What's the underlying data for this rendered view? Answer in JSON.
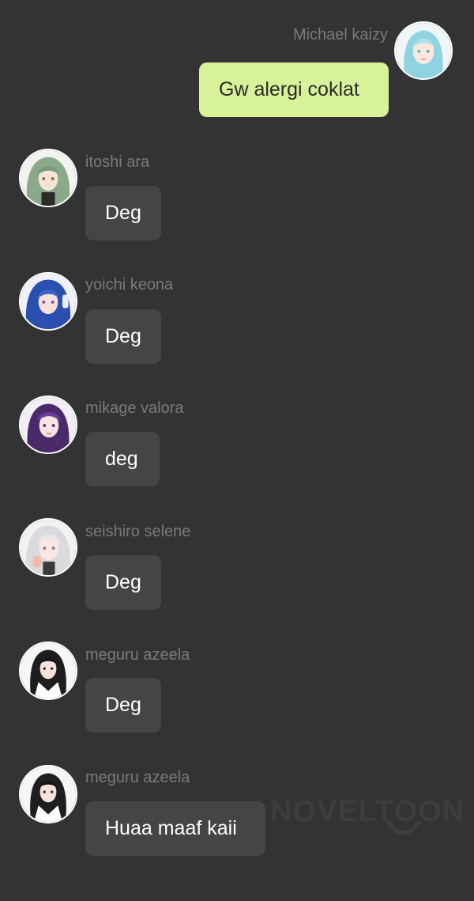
{
  "messages": [
    {
      "sender": "Michael kaizy",
      "text": "Gw alergi coklat",
      "mine": true
    },
    {
      "sender": "itoshi ara",
      "text": "Deg"
    },
    {
      "sender": "yoichi keona",
      "text": "Deg"
    },
    {
      "sender": "mikage valora",
      "text": "deg"
    },
    {
      "sender": "seishiro selene",
      "text": "Deg"
    },
    {
      "sender": "meguru azeela",
      "text": "Deg"
    },
    {
      "sender": "meguru azeela",
      "text": "Huaa maaf kaii"
    }
  ],
  "watermark": "NOVELTOON",
  "colors": {
    "background": "#333333",
    "my_bubble": "#d7f298",
    "other_bubble": "#454545",
    "sender_name": "#7a7a7a"
  }
}
